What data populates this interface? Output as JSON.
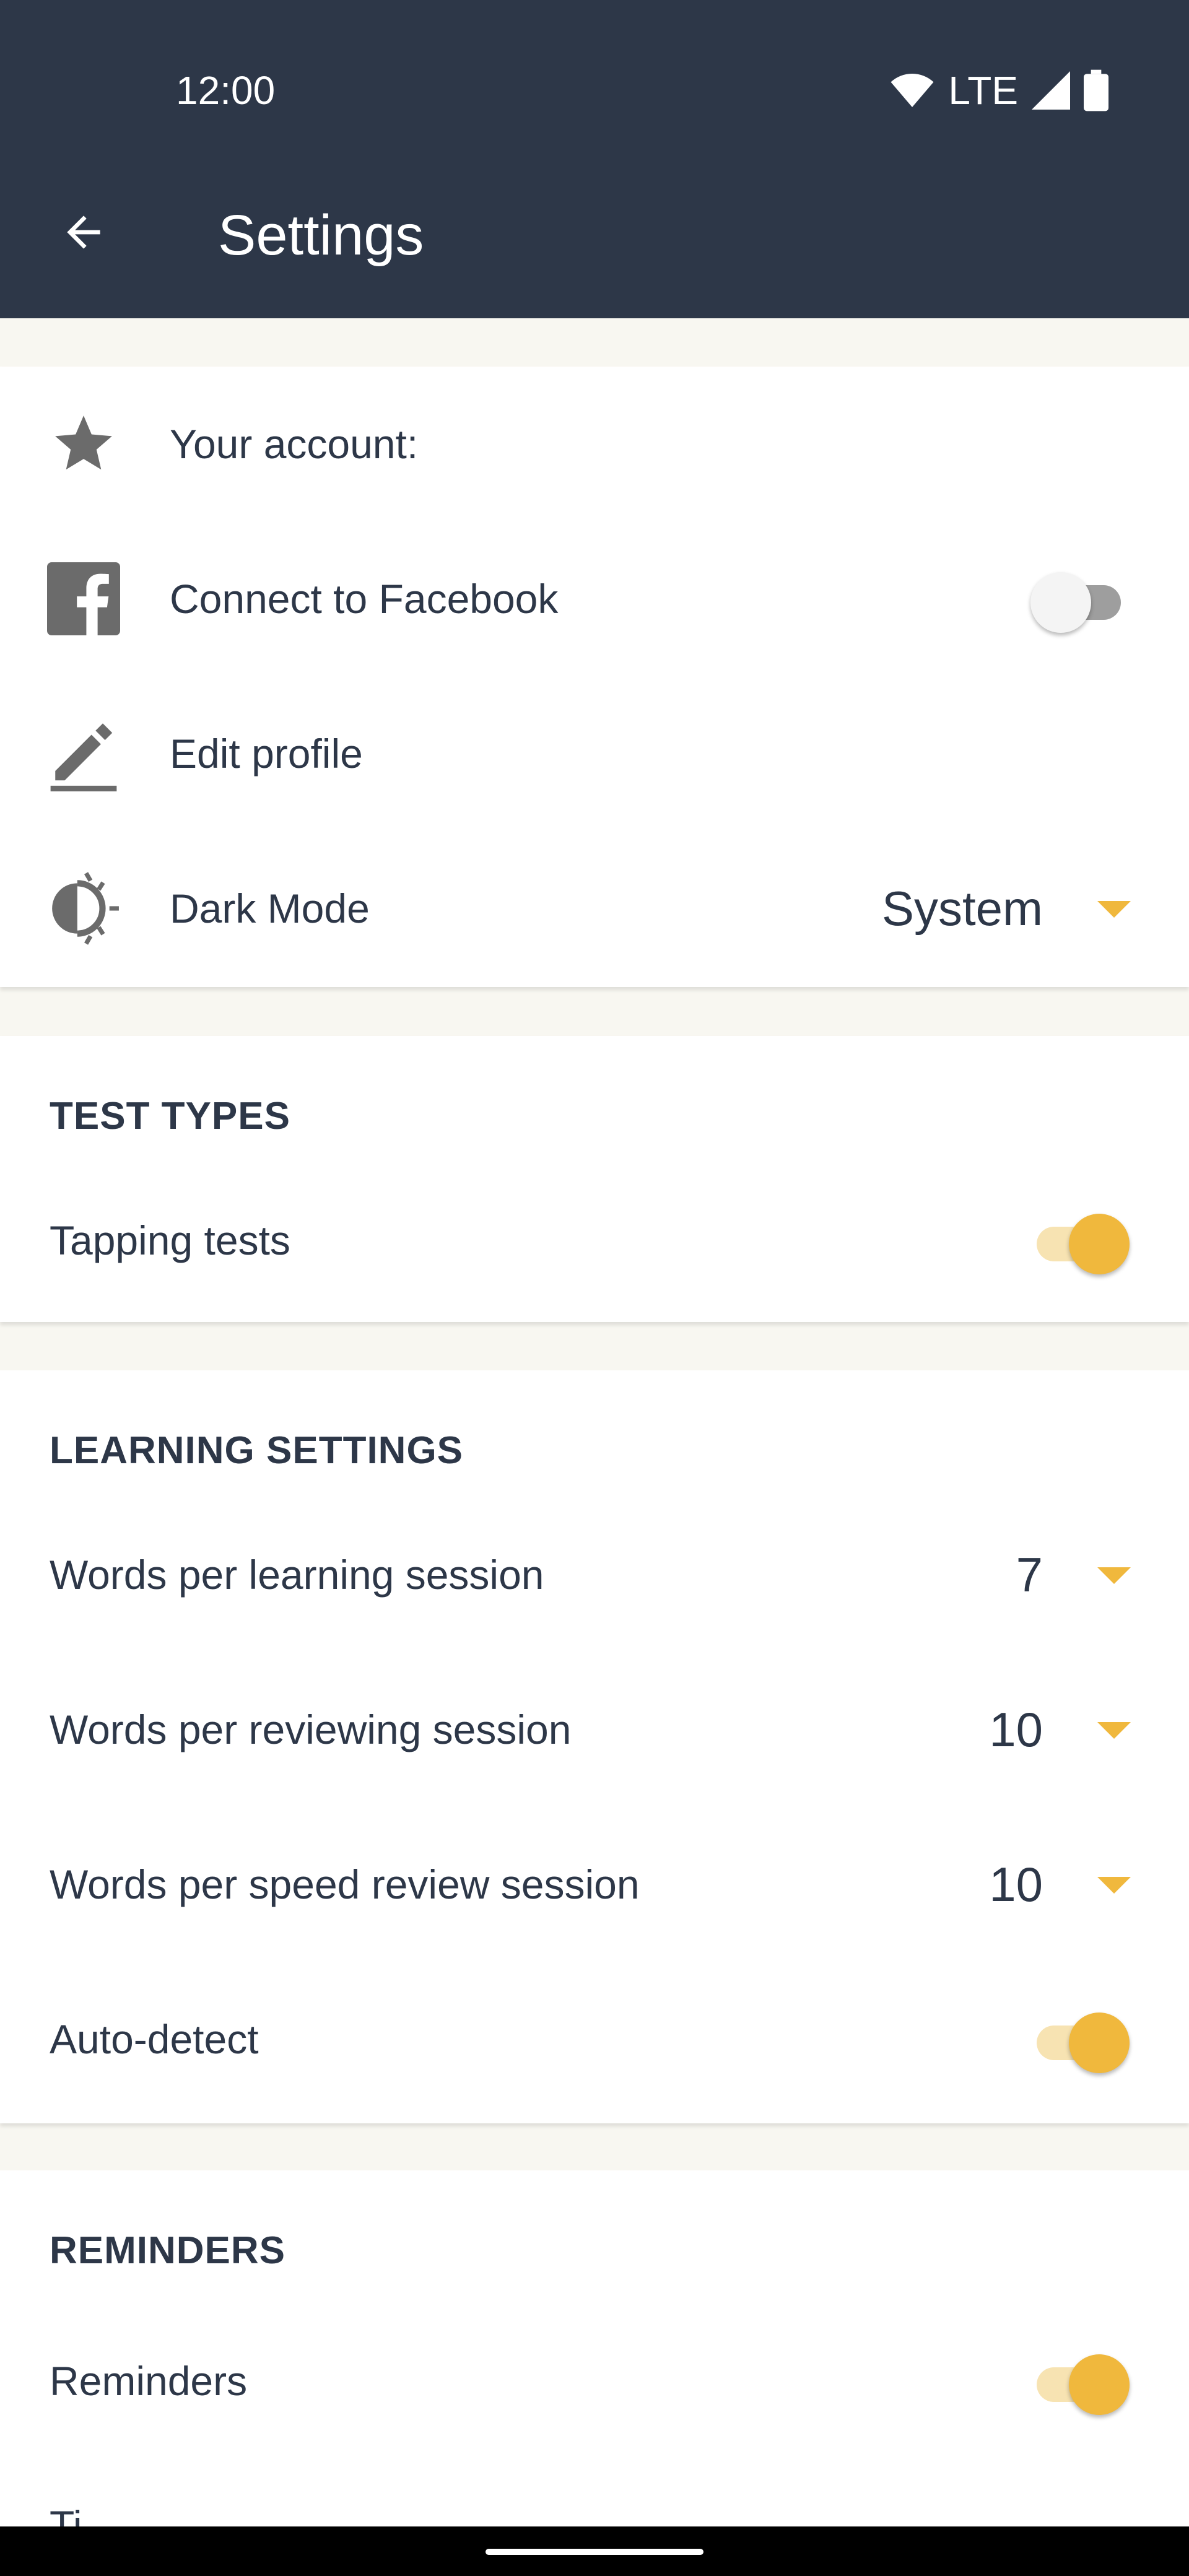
{
  "status_bar": {
    "time": "12:00",
    "network": "LTE"
  },
  "header": {
    "title": "Settings"
  },
  "account": {
    "your_account_label": "Your account:",
    "facebook_label": "Connect to Facebook",
    "facebook_connected": false,
    "edit_profile_label": "Edit profile",
    "dark_mode_label": "Dark Mode",
    "dark_mode_value": "System"
  },
  "test_types": {
    "title": "TEST TYPES",
    "tapping_tests_label": "Tapping tests",
    "tapping_tests_enabled": true
  },
  "learning_settings": {
    "title": "LEARNING SETTINGS",
    "words_learning_label": "Words per learning session",
    "words_learning_value": "7",
    "words_reviewing_label": "Words per reviewing session",
    "words_reviewing_value": "10",
    "words_speed_review_label": "Words per speed review session",
    "words_speed_review_value": "10",
    "auto_detect_label": "Auto-detect",
    "auto_detect_enabled": true
  },
  "reminders": {
    "title": "REMINDERS",
    "reminders_label": "Reminders",
    "reminders_enabled": true,
    "next_row_partial_label": "Ti"
  },
  "colors": {
    "header_bg": "#2d3748",
    "accent": "#f0b83d",
    "page_bg": "#f8f7f1"
  },
  "icons": [
    "back-arrow-icon",
    "wifi-icon",
    "cell-signal-icon",
    "battery-icon",
    "star-icon",
    "facebook-icon",
    "pencil-icon",
    "dark-mode-icon",
    "dropdown-caret-icon"
  ]
}
